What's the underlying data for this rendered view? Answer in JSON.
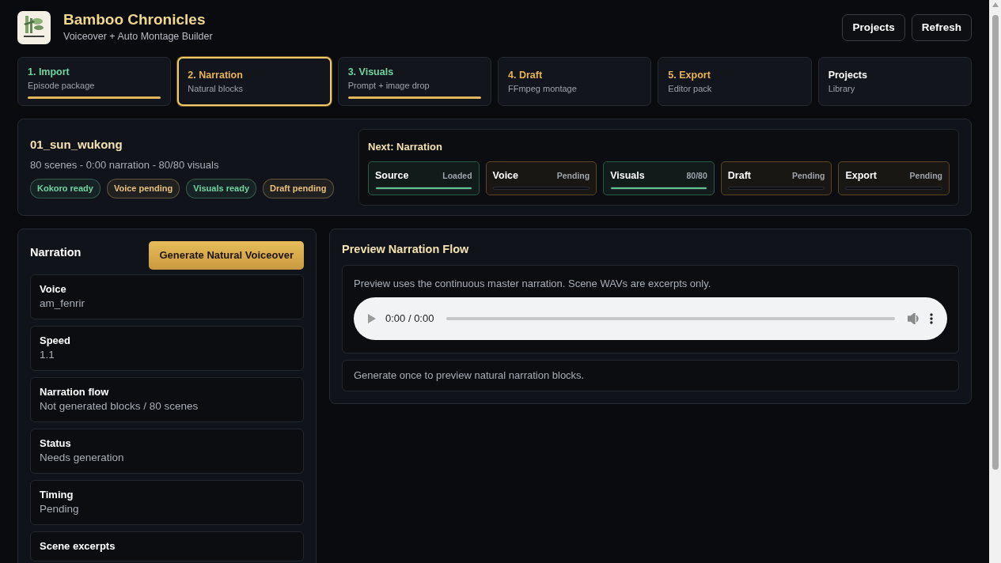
{
  "header": {
    "title": "Bamboo Chronicles",
    "subtitle": "Voiceover + Auto Montage Builder",
    "buttons": [
      "Projects",
      "Refresh"
    ]
  },
  "steps": [
    {
      "title": "1. Import",
      "subtitle": "Episode package",
      "color": "#6fd3a0",
      "selected": false,
      "level": 1
    },
    {
      "title": "2. Narration",
      "subtitle": "Natural blocks",
      "color": "#e8b455",
      "selected": true
    },
    {
      "title": "3. Visuals",
      "subtitle": "Prompt + image drop",
      "color": "#6fd3a0",
      "selected": false,
      "level": 1
    },
    {
      "title": "4. Draft",
      "subtitle": "FFmpeg montage",
      "color": "#e8b455",
      "selected": false
    },
    {
      "title": "5. Export",
      "subtitle": "Editor pack",
      "color": "#e8b455",
      "selected": false
    },
    {
      "title": "Projects",
      "subtitle": "Library",
      "color": "#ffffff",
      "selected": false
    }
  ],
  "episode": {
    "name": "01_sun_wukong",
    "summary": "80 scenes - 0:00 narration - 80/80 visuals",
    "badges": [
      {
        "label": "Kokoro ready",
        "color": "#6fd3a0"
      },
      {
        "label": "Voice pending",
        "color": "#e8c07a"
      },
      {
        "label": "Visuals ready",
        "color": "#6fd3a0"
      },
      {
        "label": "Draft pending",
        "color": "#e8c07a"
      }
    ]
  },
  "pipeline": {
    "title": "Next: Narration",
    "stages": [
      {
        "name": "Source",
        "value": "Loaded",
        "color": "#2b5a44",
        "level": 1
      },
      {
        "name": "Voice",
        "value": "Pending",
        "color": "#5a4423",
        "level": 0
      },
      {
        "name": "Visuals",
        "value": "80/80",
        "color": "#2b5a44",
        "level": 1
      },
      {
        "name": "Draft",
        "value": "Pending",
        "color": "#5a4423",
        "level": 0
      },
      {
        "name": "Export",
        "value": "Pending",
        "color": "#5a4423",
        "level": 0
      }
    ]
  },
  "narration": {
    "title": "Narration",
    "button": "Generate Natural Voiceover",
    "fields": [
      {
        "label": "Voice",
        "value": "am_fenrir"
      },
      {
        "label": "Speed",
        "value": "1.1"
      },
      {
        "label": "Narration flow",
        "value": "Not generated blocks / 80 scenes"
      },
      {
        "label": "Status",
        "value": "Needs generation"
      },
      {
        "label": "Timing",
        "value": "Pending"
      },
      {
        "label": "Scene excerpts"
      }
    ]
  },
  "preview": {
    "title": "Preview Narration Flow",
    "note": "Preview uses the continuous master narration. Scene WAVs are excerpts only.",
    "player": {
      "time": "0:00 / 0:00",
      "level": 0
    },
    "hint": "Generate once to preview natural narration blocks."
  }
}
